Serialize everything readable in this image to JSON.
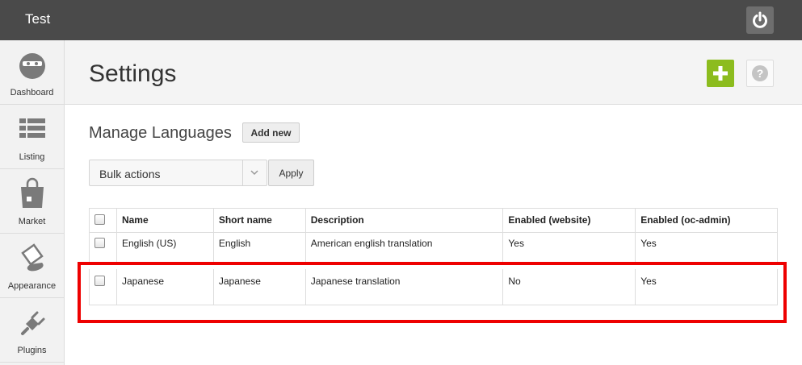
{
  "topbar": {
    "site_title": "Test",
    "power_icon": "power-icon"
  },
  "sidebar": {
    "items": [
      {
        "label": "Dashboard",
        "icon": "dashboard-icon"
      },
      {
        "label": "Listing",
        "icon": "listing-icon"
      },
      {
        "label": "Market",
        "icon": "market-bag-icon"
      },
      {
        "label": "Appearance",
        "icon": "paint-bucket-icon"
      },
      {
        "label": "Plugins",
        "icon": "plug-icon"
      }
    ]
  },
  "header": {
    "title": "Settings",
    "add_icon": "plus-icon",
    "help_icon": "question-icon"
  },
  "manage": {
    "title": "Manage Languages",
    "add_new_label": "Add new",
    "bulk_actions": "Bulk actions",
    "apply_label": "Apply"
  },
  "table": {
    "columns": [
      "Name",
      "Short name",
      "Description",
      "Enabled (website)",
      "Enabled (oc-admin)"
    ],
    "rows": [
      [
        "English (US)",
        "English",
        "American english translation",
        "Yes",
        "Yes"
      ],
      [
        "Japanese",
        "Japanese",
        "Japanese translation",
        "No",
        "Yes"
      ]
    ]
  },
  "colors": {
    "topbar": "#4a4a4a",
    "accent_green": "#8cbc1e",
    "highlight": "#ee0000"
  }
}
